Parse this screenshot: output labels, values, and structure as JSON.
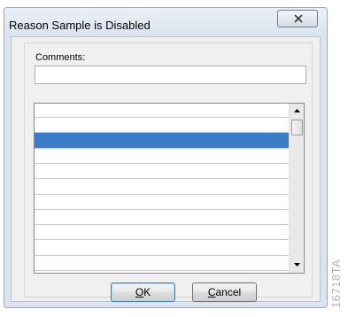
{
  "window": {
    "title": "Reason Sample is Disabled",
    "close_icon": "close-x-icon"
  },
  "comments": {
    "label": "Comments:",
    "value": ""
  },
  "list": {
    "selected_index": 1,
    "rows": [
      "",
      "",
      "",
      "",
      "",
      "",
      "",
      "",
      "",
      "",
      ""
    ]
  },
  "buttons": {
    "ok": {
      "mnemonic": "O",
      "rest": "K"
    },
    "cancel": {
      "mnemonic": "C",
      "rest": "ancel"
    }
  },
  "figure_id": "16718TA",
  "colors": {
    "selection": "#3b7dc8",
    "titlebar": "#dae3ef",
    "client": "#f0f0f0"
  }
}
